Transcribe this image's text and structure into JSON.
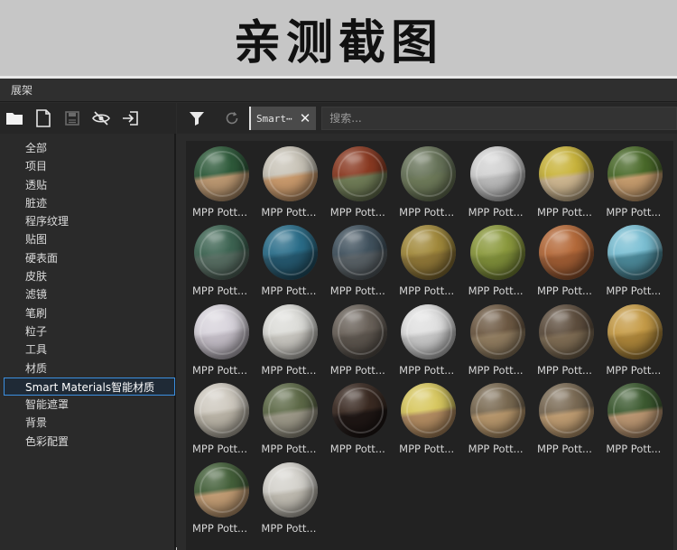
{
  "banner": {
    "title": "亲测截图"
  },
  "window": {
    "title": "展架"
  },
  "left_toolbar": {
    "icons": [
      "folder-icon",
      "new-file-icon",
      "save-icon",
      "hide-icon",
      "import-icon"
    ]
  },
  "categories": [
    {
      "label": "全部"
    },
    {
      "label": "项目"
    },
    {
      "label": "透贴"
    },
    {
      "label": "脏迹"
    },
    {
      "label": "程序纹理"
    },
    {
      "label": "贴图"
    },
    {
      "label": "硬表面"
    },
    {
      "label": "皮肤"
    },
    {
      "label": "滤镜"
    },
    {
      "label": "笔刷"
    },
    {
      "label": "粒子"
    },
    {
      "label": "工具"
    },
    {
      "label": "材质"
    },
    {
      "label": "Smart Materials智能材质",
      "selected": true
    },
    {
      "label": "智能遮罩"
    },
    {
      "label": "背景"
    },
    {
      "label": "色彩配置"
    }
  ],
  "right_toolbar": {
    "filter_icon": "filter-icon",
    "refresh_icon": "refresh-icon",
    "tag_label": "Smart⋯",
    "tag_close": "✕",
    "search_placeholder": "搜索..."
  },
  "materials": [
    {
      "label": "MPP Pott...",
      "top": "#2e5a3a",
      "bottom": "#b99670"
    },
    {
      "label": "MPP Pott...",
      "top": "#c9c4b8",
      "bottom": "#c7986b"
    },
    {
      "label": "MPP Pott...",
      "top": "#8a3a22",
      "bottom": "#6e7a55"
    },
    {
      "label": "MPP Pott...",
      "top": "#68745a",
      "bottom": "#6c7858"
    },
    {
      "label": "MPP Pott...",
      "top": "#d2d2d2",
      "bottom": "#b8b8b8"
    },
    {
      "label": "MPP Pott...",
      "top": "#c9b43c",
      "bottom": "#cbb48e"
    },
    {
      "label": "MPP Pott...",
      "top": "#4a6a2a",
      "bottom": "#c39a6c"
    },
    {
      "label": "MPP Pott...",
      "top": "#3d6452",
      "bottom": "#556b60"
    },
    {
      "label": "MPP Pott...",
      "top": "#2b6e8a",
      "bottom": "#24566c"
    },
    {
      "label": "MPP Pott...",
      "top": "#41525e",
      "bottom": "#575f64"
    },
    {
      "label": "MPP Pott...",
      "top": "#a28a3c",
      "bottom": "#8c7436"
    },
    {
      "label": "MPP Pott...",
      "top": "#8c9a3e",
      "bottom": "#7b8a38"
    },
    {
      "label": "MPP Pott...",
      "top": "#b56a3a",
      "bottom": "#9b5a32"
    },
    {
      "label": "MPP Pott...",
      "top": "#7cc0d4",
      "bottom": "#4a8696"
    },
    {
      "label": "MPP Pott...",
      "top": "#d8d4dc",
      "bottom": "#bfb9c2"
    },
    {
      "label": "MPP Pott...",
      "top": "#dcdcd8",
      "bottom": "#c4c2bc"
    },
    {
      "label": "MPP Pott...",
      "top": "#6a625a",
      "bottom": "#5a534c"
    },
    {
      "label": "MPP Pott...",
      "top": "#e0e0e0",
      "bottom": "#c4c4c4"
    },
    {
      "label": "MPP Pott...",
      "top": "#6e5a44",
      "bottom": "#8e7a5e"
    },
    {
      "label": "MPP Pott...",
      "top": "#5e4e3e",
      "bottom": "#7c6a52"
    },
    {
      "label": "MPP Pott...",
      "top": "#c69c48",
      "bottom": "#a88238"
    },
    {
      "label": "MPP Pott...",
      "top": "#cfcac0",
      "bottom": "#b7b1a4"
    },
    {
      "label": "MPP Pott...",
      "top": "#5e6a48",
      "bottom": "#9a9686"
    },
    {
      "label": "MPP Pott...",
      "top": "#3a2a22",
      "bottom": "#1e1614"
    },
    {
      "label": "MPP Pott...",
      "top": "#d8c860",
      "bottom": "#b08a60"
    },
    {
      "label": "MPP Pott...",
      "top": "#7a6a52",
      "bottom": "#b4946a"
    },
    {
      "label": "MPP Pott...",
      "top": "#7a6a54",
      "bottom": "#bc9a70"
    },
    {
      "label": "MPP Pott...",
      "top": "#3c5a30",
      "bottom": "#b89470"
    },
    {
      "label": "MPP Pott...",
      "top": "#44603a",
      "bottom": "#bf9a72"
    },
    {
      "label": "MPP Pott...",
      "top": "#d4d2cc",
      "bottom": "#bcb8ae"
    }
  ]
}
